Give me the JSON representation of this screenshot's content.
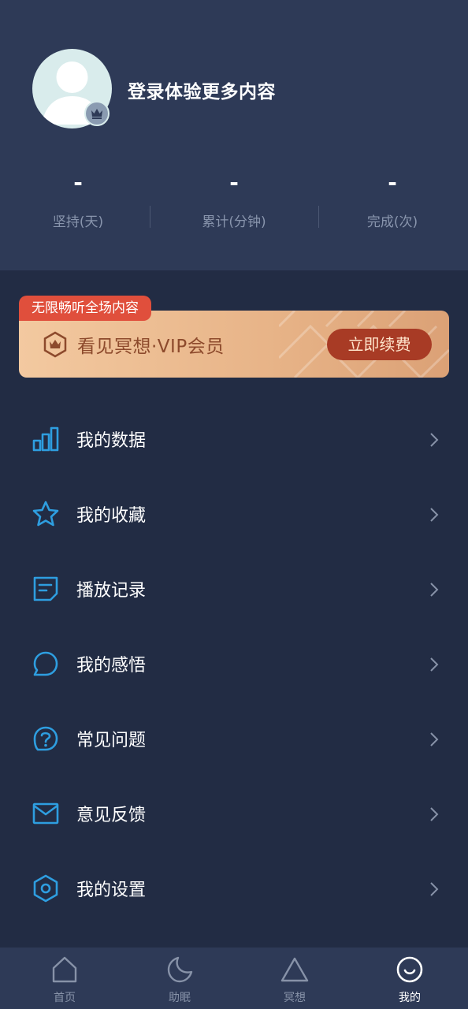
{
  "profile": {
    "login_prompt": "登录体验更多内容"
  },
  "stats": [
    {
      "value": "-",
      "label": "坚持(天)"
    },
    {
      "value": "-",
      "label": "累计(分钟)"
    },
    {
      "value": "-",
      "label": "完成(次)"
    }
  ],
  "vip": {
    "tag": "无限畅听全场内容",
    "title": "看见冥想·VIP会员",
    "renew_button": "立即续费"
  },
  "menu": [
    {
      "label": "我的数据",
      "icon": "bar-chart-icon"
    },
    {
      "label": "我的收藏",
      "icon": "star-icon"
    },
    {
      "label": "播放记录",
      "icon": "note-icon"
    },
    {
      "label": "我的感悟",
      "icon": "chat-bubble-icon"
    },
    {
      "label": "常见问题",
      "icon": "question-icon"
    },
    {
      "label": "意见反馈",
      "icon": "mail-icon"
    },
    {
      "label": "我的设置",
      "icon": "hexagon-settings-icon"
    }
  ],
  "tabs": [
    {
      "label": "首页",
      "icon": "home-icon"
    },
    {
      "label": "助眠",
      "icon": "moon-icon"
    },
    {
      "label": "冥想",
      "icon": "triangle-icon"
    },
    {
      "label": "我的",
      "icon": "smile-icon",
      "active": true
    }
  ],
  "colors": {
    "background": "#222c44",
    "header": "#2e3a57",
    "accent_blue": "#2e9ee0",
    "vip_tag": "#e04f3c",
    "vip_button": "#a83b25"
  }
}
